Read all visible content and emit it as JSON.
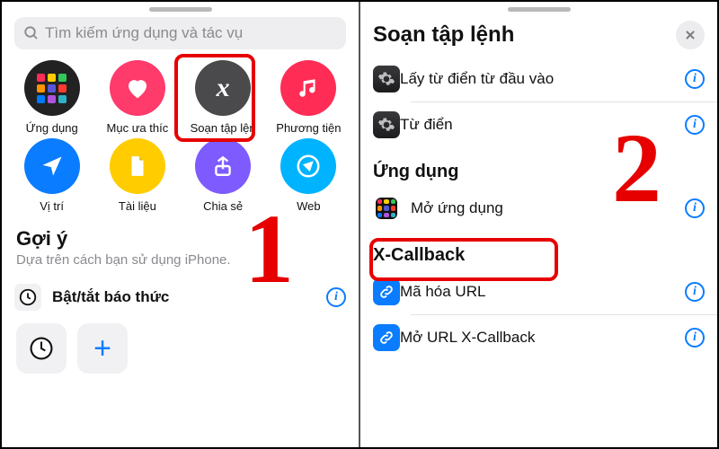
{
  "left": {
    "search_placeholder": "Tìm kiếm ứng dụng và tác vụ",
    "categories": [
      {
        "label": "Ứng dụng",
        "color": "#222",
        "icon": "apps"
      },
      {
        "label": "Mục ưa thíc",
        "color": "#ff3b6b",
        "icon": "heart"
      },
      {
        "label": "Soạn tập lện",
        "color": "#4a4a4c",
        "icon": "script"
      },
      {
        "label": "Phương tiện",
        "color": "#ff2d55",
        "icon": "music"
      },
      {
        "label": "Vị trí",
        "color": "#0a7cff",
        "icon": "location"
      },
      {
        "label": "Tài liệu",
        "color": "#ffcc00",
        "icon": "document"
      },
      {
        "label": "Chia sẻ",
        "color": "#7d5bff",
        "icon": "share"
      },
      {
        "label": "Web",
        "color": "#00b3ff",
        "icon": "compass"
      }
    ],
    "suggestions_header": "Gợi ý",
    "suggestions_sub": "Dựa trên cách bạn sử dụng iPhone.",
    "suggestion_item": "Bật/tắt báo thức"
  },
  "right": {
    "sheet_title": "Soạn tập lệnh",
    "group1": [
      "Lấy từ điển từ đầu vào",
      "Từ điển"
    ],
    "apps_header": "Ứng dụng",
    "apps_item": "Mở ứng dụng",
    "xcb_header": "X-Callback",
    "xcb_items": [
      "Mã hóa URL",
      "Mở URL X-Callback"
    ]
  },
  "callouts": {
    "one": "1",
    "two": "2"
  }
}
